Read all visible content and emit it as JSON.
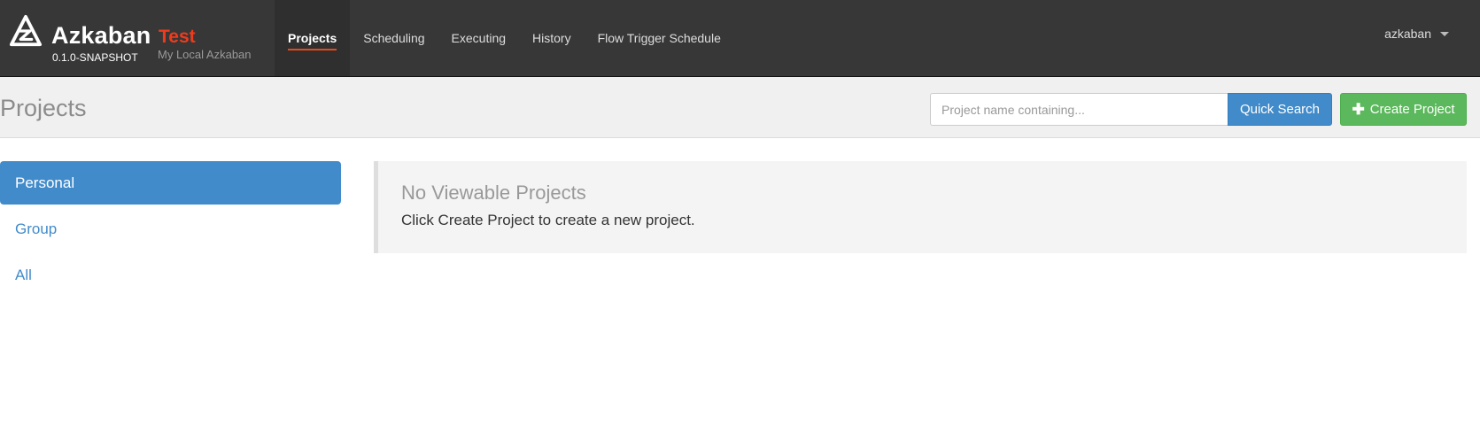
{
  "brand": {
    "name": "Azkaban",
    "version": "0.1.0-SNAPSHOT",
    "env_name": "Test",
    "env_subtitle": "My Local Azkaban",
    "logo_icon": "azkaban-logo-icon"
  },
  "nav": {
    "items": [
      {
        "label": "Projects",
        "active": true
      },
      {
        "label": "Scheduling",
        "active": false
      },
      {
        "label": "Executing",
        "active": false
      },
      {
        "label": "History",
        "active": false
      },
      {
        "label": "Flow Trigger Schedule",
        "active": false
      }
    ],
    "user": "azkaban"
  },
  "header": {
    "title": "Projects",
    "search_placeholder": "Project name containing...",
    "search_value": "",
    "quick_search_label": "Quick Search",
    "create_label": "Create Project"
  },
  "sidebar": {
    "items": [
      {
        "label": "Personal",
        "active": true
      },
      {
        "label": "Group",
        "active": false
      },
      {
        "label": "All",
        "active": false
      }
    ]
  },
  "main": {
    "empty_title": "No Viewable Projects",
    "empty_text": "Click Create Project to create a new project."
  },
  "colors": {
    "navbar": "#373737",
    "accent": "#ee3b1c",
    "primary": "#428bca",
    "success": "#5cb85c"
  }
}
